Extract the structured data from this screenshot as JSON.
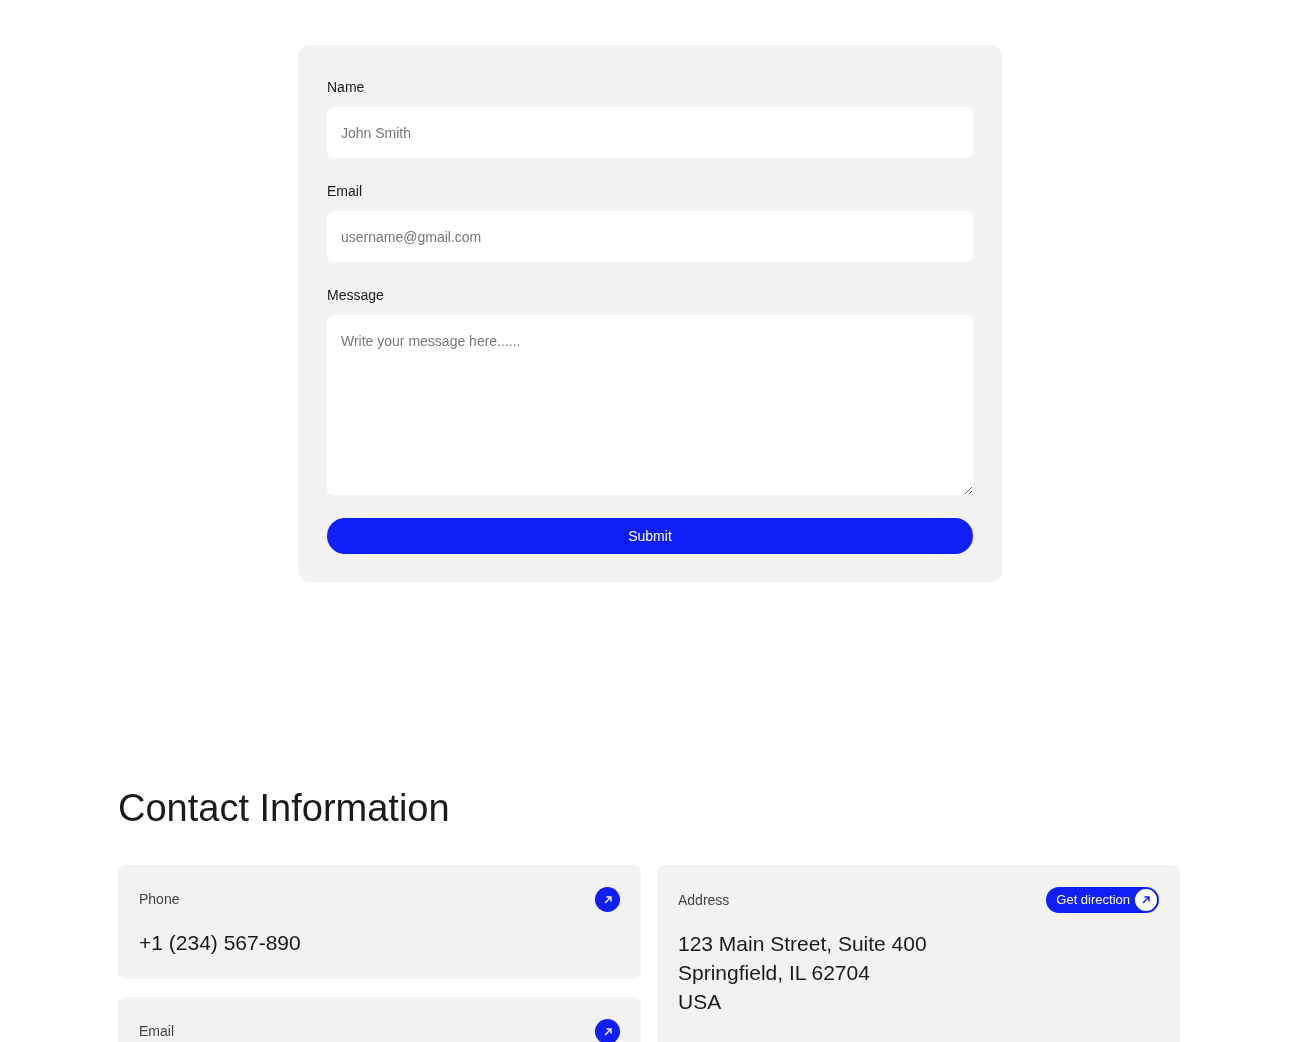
{
  "form": {
    "fields": [
      {
        "label": "Name",
        "kind": "input",
        "placeholder": "John Smith"
      },
      {
        "label": "Email",
        "kind": "input",
        "placeholder": "username@gmail.com"
      },
      {
        "label": "Message",
        "kind": "textarea",
        "placeholder": "Write your message here......"
      }
    ],
    "submit": "Submit"
  },
  "contact": {
    "title": "Contact Information",
    "left_cards": [
      {
        "label": "Phone",
        "value": "+1 (234) 567-890",
        "action": {
          "kind": "icon"
        }
      },
      {
        "label": "Email",
        "action": {
          "kind": "icon"
        }
      }
    ],
    "right_cards": [
      {
        "label": "Address",
        "value_lines": [
          "123 Main Street, Suite 400",
          "Springfield, IL 62704",
          "USA"
        ],
        "action": {
          "kind": "button",
          "label": "Get direction"
        }
      }
    ]
  }
}
